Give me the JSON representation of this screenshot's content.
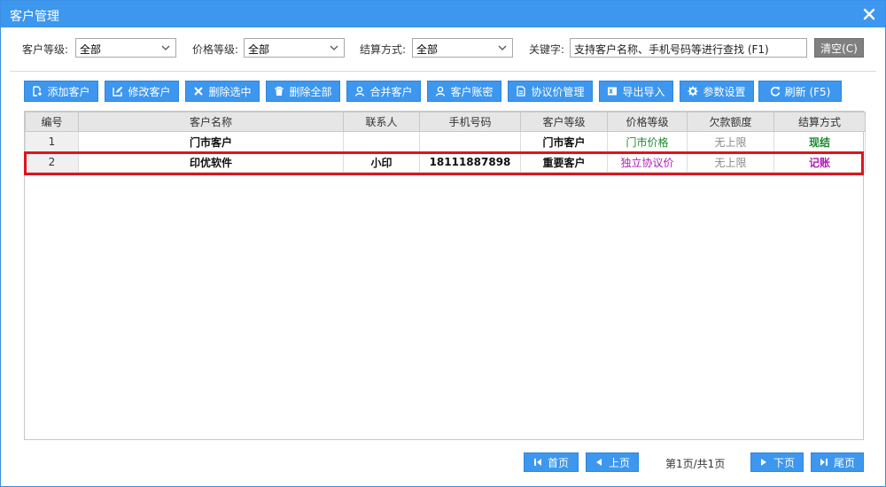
{
  "window": {
    "title": "客户管理"
  },
  "filters": {
    "customer_level": {
      "label": "客户等级:",
      "value": "全部"
    },
    "price_level": {
      "label": "价格等级:",
      "value": "全部"
    },
    "settlement": {
      "label": "结算方式:",
      "value": "全部"
    },
    "keyword": {
      "label": "关键字:",
      "value": "支持客户名称、手机号码等进行查找 (F1)"
    },
    "clear_label": "清空(C)"
  },
  "toolbar": {
    "add": "添加客户",
    "edit": "修改客户",
    "delete_selected": "删除选中",
    "delete_all": "删除全部",
    "merge": "合并客户",
    "account": "客户账密",
    "protocol_price": "协议价管理",
    "export_import": "导出导入",
    "settings": "参数设置",
    "refresh": "刷新 (F5)"
  },
  "table": {
    "headers": [
      "编号",
      "客户名称",
      "联系人",
      "手机号码",
      "客户等级",
      "价格等级",
      "欠款额度",
      "结算方式"
    ],
    "rows": [
      {
        "id": "1",
        "name": "门市客户",
        "contact": "",
        "phone": "",
        "level": "门市客户",
        "price_level": "门市价格",
        "credit": "无上限",
        "settlement": "现结"
      },
      {
        "id": "2",
        "name": "印优软件",
        "contact": "小印",
        "phone": "18111887898",
        "level": "重要客户",
        "price_level": "独立协议价",
        "credit": "无上限",
        "settlement": "记账"
      }
    ]
  },
  "pager": {
    "first": "首页",
    "prev": "上页",
    "info": "第1页/共1页",
    "next": "下页",
    "last": "尾页"
  },
  "colors": {
    "accent": "#3d97ee",
    "highlight": "#e0141e",
    "green": "#1b8a2d",
    "purple": "#b01ab8"
  }
}
